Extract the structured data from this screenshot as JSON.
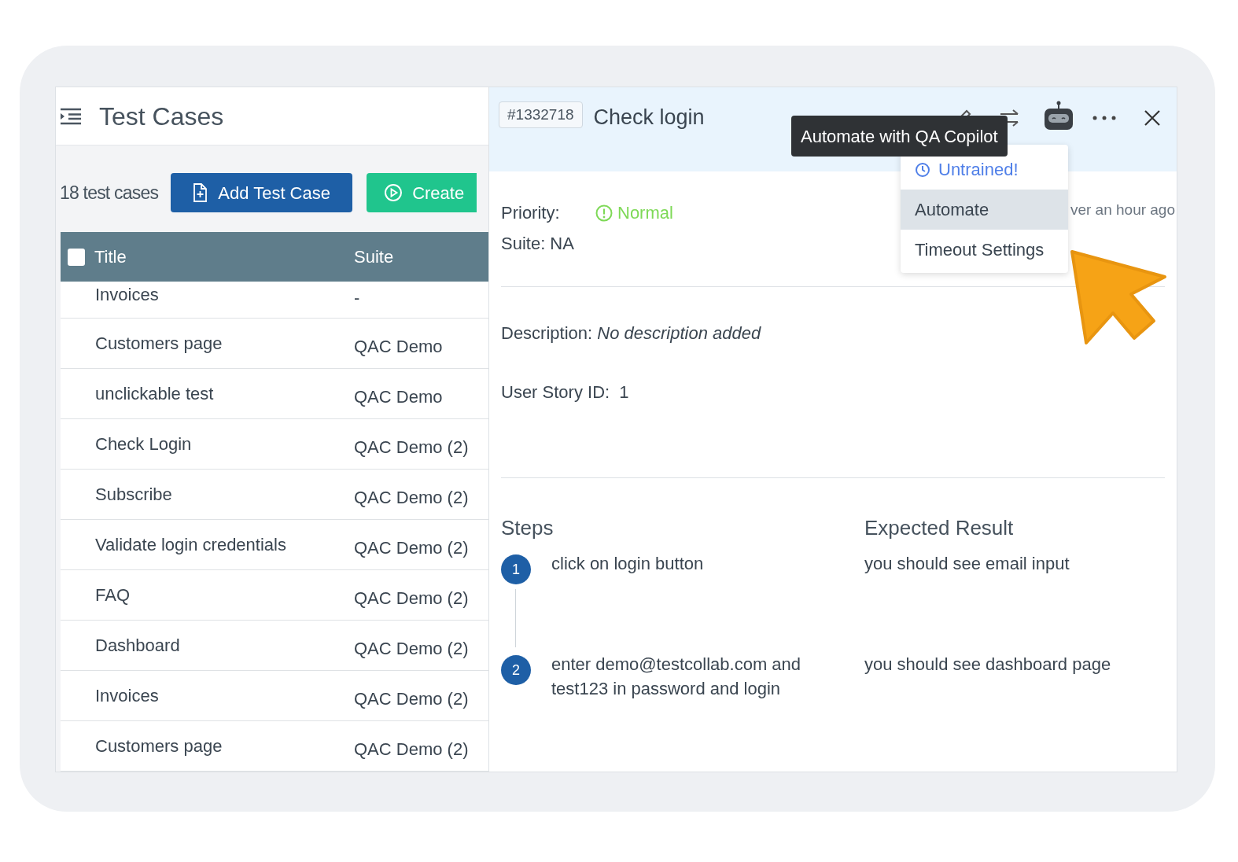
{
  "list_pane": {
    "title": "Test Cases",
    "count": "18 test cases",
    "buttons": [
      {
        "kind": "add",
        "label": "Add Test Case"
      },
      {
        "kind": "create",
        "label": "Create"
      }
    ],
    "columns": [
      "Title",
      "Suite"
    ],
    "select_all_checked": false,
    "rows": [
      {
        "title": "Invoices",
        "suite": "-"
      },
      {
        "title": "Customers page",
        "suite": "QAC Demo"
      },
      {
        "title": "unclickable test",
        "suite": "QAC Demo"
      },
      {
        "title": "Check Login",
        "suite": "QAC Demo (2)"
      },
      {
        "title": "Subscribe",
        "suite": "QAC Demo (2)"
      },
      {
        "title": "Validate login credentials",
        "suite": "QAC Demo (2)"
      },
      {
        "title": "FAQ",
        "suite": "QAC Demo (2)"
      },
      {
        "title": "Dashboard",
        "suite": "QAC Demo (2)"
      },
      {
        "title": "Invoices",
        "suite": "QAC Demo (2)"
      },
      {
        "title": "Customers page",
        "suite": "QAC Demo (2)"
      }
    ]
  },
  "detail": {
    "id": "#1332718",
    "title": "Check login",
    "tooltip": "Automate with QA Copilot",
    "menu": [
      {
        "kind": "status",
        "label": "Untrained!",
        "selected": false
      },
      {
        "kind": "item",
        "label": "Automate",
        "selected": true
      },
      {
        "kind": "item",
        "label": "Timeout Settings",
        "selected": false
      }
    ],
    "priority_label": "Priority:",
    "priority": "Normal",
    "suite": "Suite: NA",
    "updated": "ver an hour ago",
    "description_label": "Description:",
    "description": "No description added",
    "user_story": "User Story ID:  1",
    "steps_heading": "Steps",
    "expected_heading": "Expected Result",
    "steps": [
      {
        "number": "1",
        "step": "click on login button",
        "expected": "you should see email input"
      },
      {
        "number": "2",
        "step": "enter demo@testcollab.com and test123 in password and login",
        "expected": "you should see dashboard page"
      }
    ]
  }
}
